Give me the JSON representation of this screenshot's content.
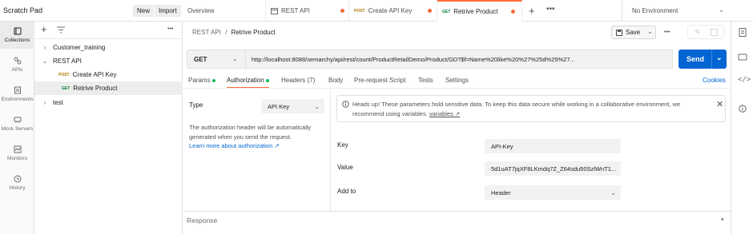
{
  "sidebar": {
    "workspace_title": "Scratch Pad",
    "new_label": "New",
    "import_label": "Import",
    "rail": [
      {
        "label": "Collections",
        "icon": "collections-icon"
      },
      {
        "label": "APIs",
        "icon": "apis-icon"
      },
      {
        "label": "Environments",
        "icon": "environments-icon"
      },
      {
        "label": "Mock Servers",
        "icon": "mock-servers-icon"
      },
      {
        "label": "Monitors",
        "icon": "monitors-icon"
      },
      {
        "label": "History",
        "icon": "history-icon"
      }
    ],
    "tree": [
      {
        "label": "Customer_training"
      },
      {
        "label": "REST API"
      },
      {
        "method": "POST",
        "label": "Create API Key"
      },
      {
        "method": "GET",
        "label": "Retrive Product"
      },
      {
        "label": "test"
      }
    ]
  },
  "tabs": [
    {
      "label": "Overview"
    },
    {
      "label": "REST API"
    },
    {
      "method": "POST",
      "label": "Create API Key"
    },
    {
      "method": "GET",
      "label": "Retrive Product"
    }
  ],
  "environment": {
    "label": "No Environment"
  },
  "request": {
    "breadcrumb_parent": "REST API",
    "breadcrumb_sep": "/",
    "breadcrumb_current": "Retrive Product",
    "save_label": "Save",
    "method": "GET",
    "url": "http://localhost:8088/semarchy/api/rest/count/ProductRetailDemo/Product/GD?$f=Name%20like%20%27%25d%25%27...",
    "send_label": "Send"
  },
  "subtabs": [
    {
      "label": "Params"
    },
    {
      "label": "Authorization"
    },
    {
      "label": "Headers (7)"
    },
    {
      "label": "Body"
    },
    {
      "label": "Pre-request Script"
    },
    {
      "label": "Tests"
    },
    {
      "label": "Settings"
    }
  ],
  "cookies_label": "Cookies",
  "auth": {
    "type_label": "Type",
    "type_value": "API Key",
    "description": "The authorization header will be automatically generated when you send the request.",
    "learn_more": "Learn more about authorization ↗",
    "warning_text": "Heads up! These parameters hold sensitive data. To keep this data secure while working in a collaborative environment, we recommend using variables.",
    "warning_link": "variables ↗",
    "key_label": "Key",
    "key_value": "API-Key",
    "value_label": "Value",
    "value_value": "5d1uAT7jqXF8LKmdq7Z_Z64sdu50SzlWnT1...",
    "addto_label": "Add to",
    "addto_value": "Header"
  },
  "response_label": "Response",
  "colors": {
    "accent": "#ff6c37",
    "send": "#0265d2",
    "get": "#007f31",
    "post": "#ad7a03"
  }
}
